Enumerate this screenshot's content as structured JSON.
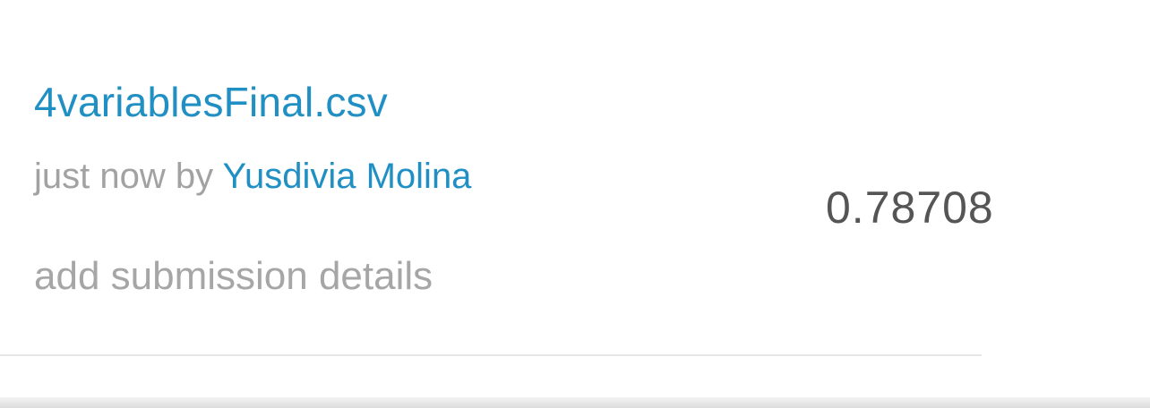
{
  "submission": {
    "file_name": "4variablesFinal.csv",
    "time": "just now by",
    "author": "Yusdivia Molina",
    "details_link": "add submission details",
    "score": "0.78708"
  },
  "colors": {
    "link": "#1f8fc4",
    "muted": "#a2a2a2",
    "score": "#555555"
  }
}
